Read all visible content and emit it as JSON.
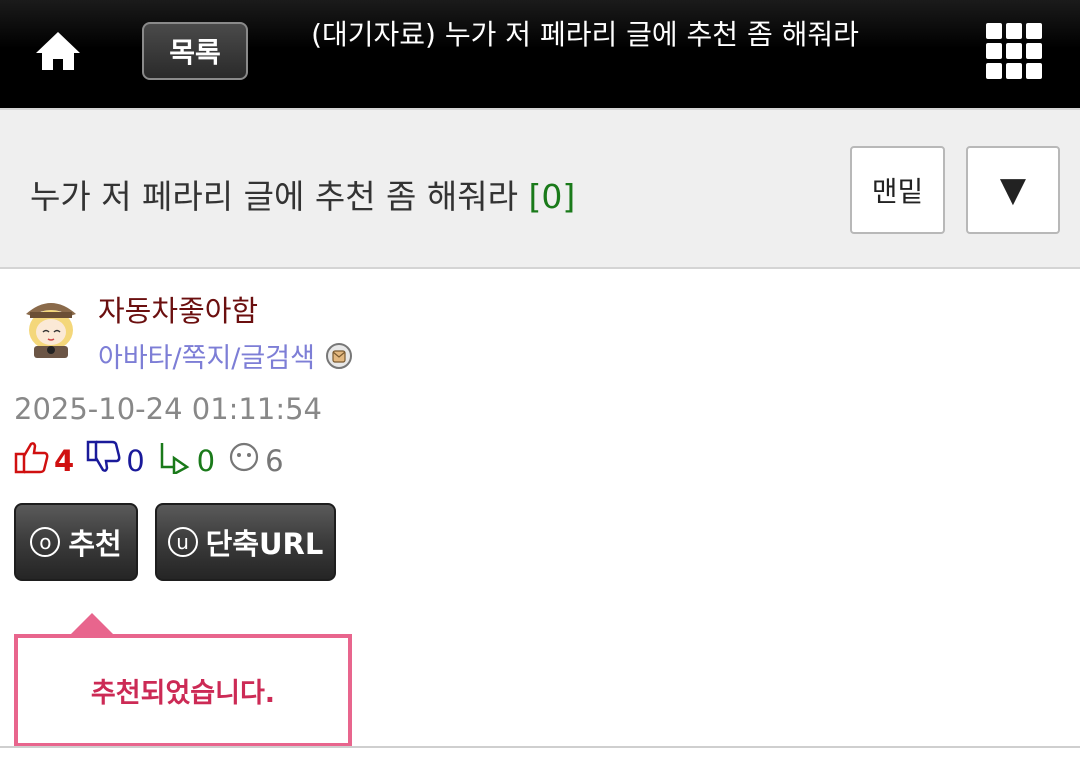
{
  "topbar": {
    "home_icon": "home-icon",
    "list_label": "목록",
    "title": "(대기자료) 누가 저 페라리 글에 추천 좀 해줘라",
    "grid_icon": "grid-menu-icon"
  },
  "header": {
    "title": "누가 저 페라리 글에 추천 좀 해줘라",
    "comment_count": "[0]",
    "bottom_label": "맨밑",
    "dropdown_label": "▼"
  },
  "author": {
    "name": "자동차좋아함",
    "links": "아바타/쪽지/글검색",
    "avatar_icon": "detective-avatar-icon"
  },
  "post": {
    "date": "2025-10-24 01:11:54",
    "upvotes": "4",
    "downvotes": "0",
    "shares": "0",
    "views": "6"
  },
  "actions": {
    "recommend_key": "o",
    "recommend_label": "추천",
    "shorturl_key": "u",
    "shorturl_label": "단축URL"
  },
  "tooltip": {
    "message": "추천되었습니다."
  },
  "colors": {
    "count_green": "#1a7a1a",
    "author_name": "#6b0f0f",
    "author_links": "#7d7ed6",
    "upvote": "#d01010",
    "downvote": "#1a1a9a",
    "tooltip_border": "#e8658d",
    "tooltip_text": "#cc2a55"
  }
}
